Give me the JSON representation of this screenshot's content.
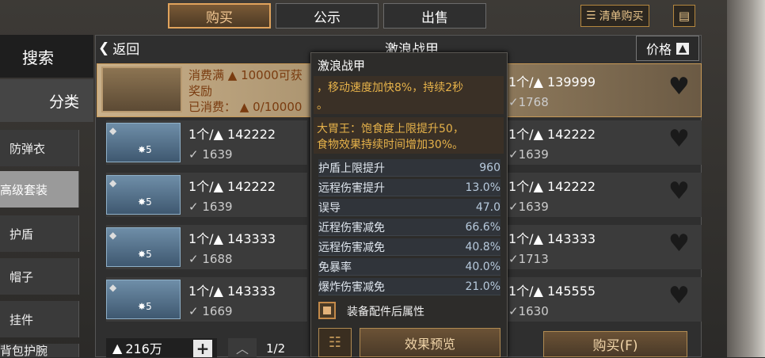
{
  "tabs": [
    "购买",
    "公示",
    "出售"
  ],
  "cart_label": "清单购买",
  "nav": {
    "search": "搜索",
    "category": "分类",
    "items": [
      "防弹衣",
      "高级套装",
      "护盾",
      "帽子",
      "挂件",
      "背包护腕"
    ]
  },
  "header": {
    "back": "返回",
    "title": "激浪战甲",
    "sort": "价格"
  },
  "banner": {
    "line1": "消费满",
    "amount": "10000可获",
    "line2": "奖励",
    "spent_label": "已消费：",
    "spent": "0/10000"
  },
  "left_rows": [
    {
      "qty": "1个/",
      "price": "142222",
      "level_badge": "5",
      "score": "1639"
    },
    {
      "qty": "1个/",
      "price": "142222",
      "level_badge": "5",
      "score": "1639"
    },
    {
      "qty": "1个/",
      "price": "143333",
      "level_badge": "5",
      "score": "1688"
    },
    {
      "qty": "1个/",
      "price": "143333",
      "level_badge": "5",
      "score": "1669"
    }
  ],
  "right_rows": [
    {
      "qty": "1个/",
      "price": "139999",
      "score": "1768"
    },
    {
      "qty": "1个/",
      "price": "142222",
      "score": "1639"
    },
    {
      "qty": "1个/",
      "price": "142222",
      "score": "1639"
    },
    {
      "qty": "1个/",
      "price": "143333",
      "score": "1713"
    },
    {
      "qty": "1个/",
      "price": "145555",
      "score": "1630"
    }
  ],
  "tooltip": {
    "title": "激浪战甲",
    "effect1": "，移动速度加快8%，持续2秒",
    "effect1b": "。",
    "effect2": "大胃王：饱食度上限提升50，",
    "effect2b": "食物效果持续时间增加30%。",
    "stats": [
      {
        "name": "护盾上限提升",
        "value": "960"
      },
      {
        "name": "远程伤害提升",
        "value": "13.0%"
      },
      {
        "name": "误导",
        "value": "47.0"
      },
      {
        "name": "近程伤害减免",
        "value": "66.6%"
      },
      {
        "name": "远程伤害减免",
        "value": "40.8%"
      },
      {
        "name": "免暴率",
        "value": "40.0%"
      },
      {
        "name": "爆炸伤害减免",
        "value": "21.0%"
      }
    ],
    "checkbox_label": "装备配件后属性",
    "preview_button": "效果预览"
  },
  "footer": {
    "money": "216万",
    "page": "1/2",
    "buy": "购买(F)"
  }
}
